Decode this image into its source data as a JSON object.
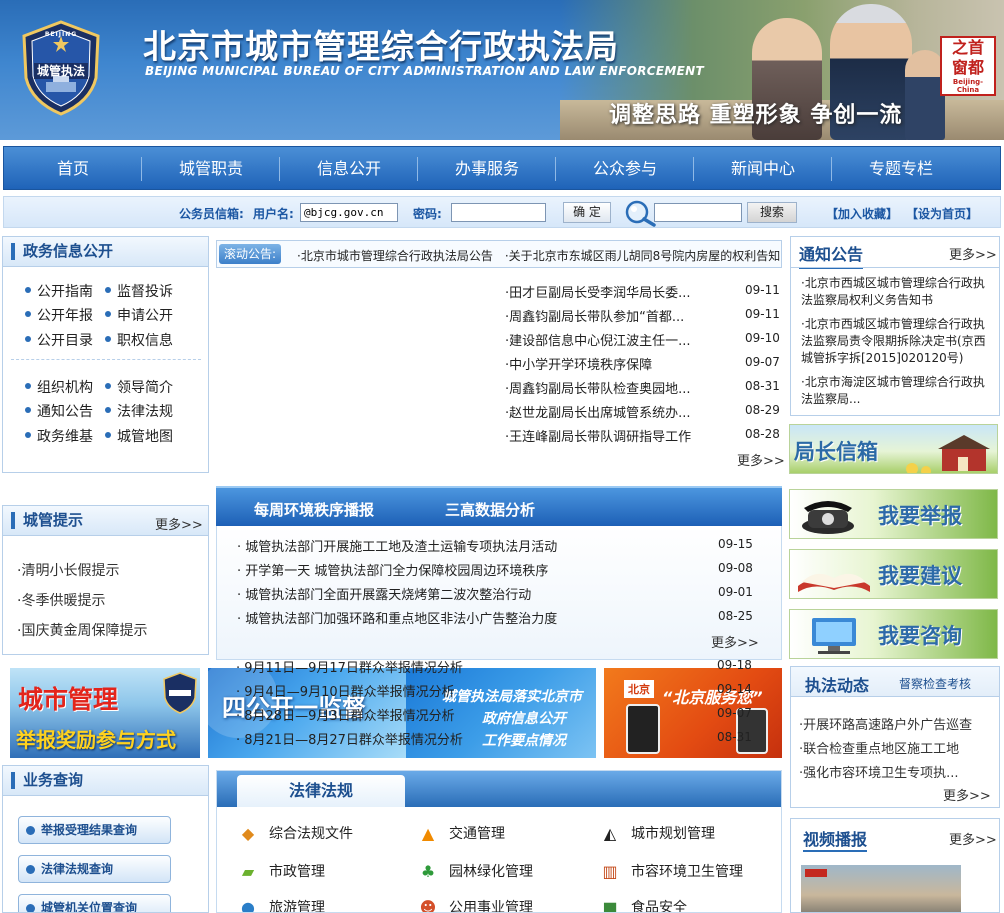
{
  "header": {
    "title_cn": "北京市城市管理综合行政执法局",
    "title_en": "BEIJING MUNICIPAL BUREAU OF CITY ADMINISTRATION AND LAW ENFORCEMENT",
    "slogan": "调整思路 重塑形象 争创一流",
    "badge_text": "城管执法",
    "badge_top": "BEIJING",
    "seal_line1": "之首",
    "seal_line2": "窗都",
    "seal_sub": "Beijing-China"
  },
  "nav": [
    "首页",
    "城管职责",
    "信息公开",
    "办事服务",
    "公众参与",
    "新闻中心",
    "专题专栏"
  ],
  "login": {
    "mail_label": "公务员信箱:",
    "user_label": "用户名:",
    "user_value": "@bjcg.gov.cn",
    "pwd_label": "密码:",
    "confirm": "确 定",
    "search_btn": "搜索",
    "fav": "【加入收藏】",
    "home": "【设为首页】"
  },
  "gov_info": {
    "title": "政务信息公开",
    "items1": [
      "公开指南",
      "监督投诉",
      "公开年报",
      "申请公开",
      "公开目录",
      "职权信息"
    ],
    "items2": [
      "组织机构",
      "领导简介",
      "通知公告",
      "法律法规",
      "政务维基",
      "城管地图"
    ]
  },
  "scroll": {
    "label": "滚动公告:",
    "text": "·北京市城市管理综合行政执法局公告　·关于北京市东城区雨儿胡同8号院内房屋的权利告知"
  },
  "news": {
    "items": [
      {
        "title": "田才巨副局长受李润华局长委...",
        "date": "09-11"
      },
      {
        "title": "周鑫钧副局长带队参加“首都...",
        "date": "09-11"
      },
      {
        "title": "建设部信息中心倪江波主任一...",
        "date": "09-10"
      },
      {
        "title": "中小学开学环境秩序保障",
        "date": "09-07"
      },
      {
        "title": "周鑫钧副局长带队检查奥园地...",
        "date": "08-31"
      },
      {
        "title": "赵世龙副局长出席城管系统办...",
        "date": "08-29"
      },
      {
        "title": "王连峰副局长带队调研指导工作",
        "date": "08-28"
      }
    ],
    "more": "更多>>"
  },
  "notice": {
    "title": "通知公告",
    "more": "更多>>",
    "items": [
      "北京市西城区城市管理综合行政执法监察局权利义务告知书",
      "北京市西城区城市管理综合行政执法监察局责令限期拆除决定书(京西城管拆字拆[2015]020120号)",
      "北京市海淀区城市管理综合行政执法监察局..."
    ]
  },
  "side_links": [
    "局长信箱",
    "我要举报",
    "我要建议",
    "我要咨询"
  ],
  "tips": {
    "title": "城管提示",
    "more": "更多>>",
    "items": [
      "清明小长假提示",
      "冬季供暖提示",
      "国庆黄金周保障提示"
    ]
  },
  "env": {
    "tab1": "每周环境秩序播报",
    "tab2": "三高数据分析",
    "items": [
      {
        "title": "城管执法部门开展施工工地及渣土运输专项执法月活动",
        "date": "09-15"
      },
      {
        "title": "开学第一天 城管执法部门全力保障校园周边环境秩序",
        "date": "09-08"
      },
      {
        "title": "城管执法部门全面开展露天烧烤第二波次整治行动",
        "date": "09-01"
      },
      {
        "title": "城管执法部门加强环路和重点地区非法小广告整治力度",
        "date": "08-25"
      }
    ],
    "more": "更多>>",
    "items2": [
      {
        "title": "9月11日—9月17日群众举报情况分析",
        "date": "09-18"
      },
      {
        "title": "9月4日—9月10日群众举报情况分析",
        "date": "09-14"
      },
      {
        "title": "8月28日—9月3日群众举报情况分析",
        "date": "09-07"
      },
      {
        "title": "8月21日—8月27日群众举报情况分析",
        "date": "08-31"
      }
    ]
  },
  "promos": {
    "p1_line1": "城市管理",
    "p1_line2": "举报奖励参与方式",
    "p2": "四公开一监督",
    "p3_line1": "城管执法局落实北京市",
    "p3_line2": "政府信息公开",
    "p3_line3": "工作要点情况",
    "p4_tag": "北京",
    "p4": "“北京服务您”"
  },
  "enforce": {
    "tab1": "执法动态",
    "tab2": "督察检查考核",
    "items": [
      "开展环路高速路户外广告巡查",
      "联合检查重点地区施工工地",
      "强化市容环境卫生专项执..."
    ],
    "more": "更多>>"
  },
  "video": {
    "title": "视频播报",
    "more": "更多>>"
  },
  "business": {
    "title": "业务查询",
    "items": [
      "举报受理结果查询",
      "法律法规查询",
      "城管机关位置查询"
    ]
  },
  "law": {
    "title": "法律法规",
    "items": [
      "综合法规文件",
      "交通管理",
      "城市规划管理",
      "市政管理",
      "园林绿化管理",
      "市容环境卫生管理",
      "旅游管理",
      "公用事业管理",
      "食品安全"
    ]
  },
  "colors": {
    "brand": "#2a6db7",
    "nav": "#1f63b8",
    "link": "#1c57a3"
  }
}
